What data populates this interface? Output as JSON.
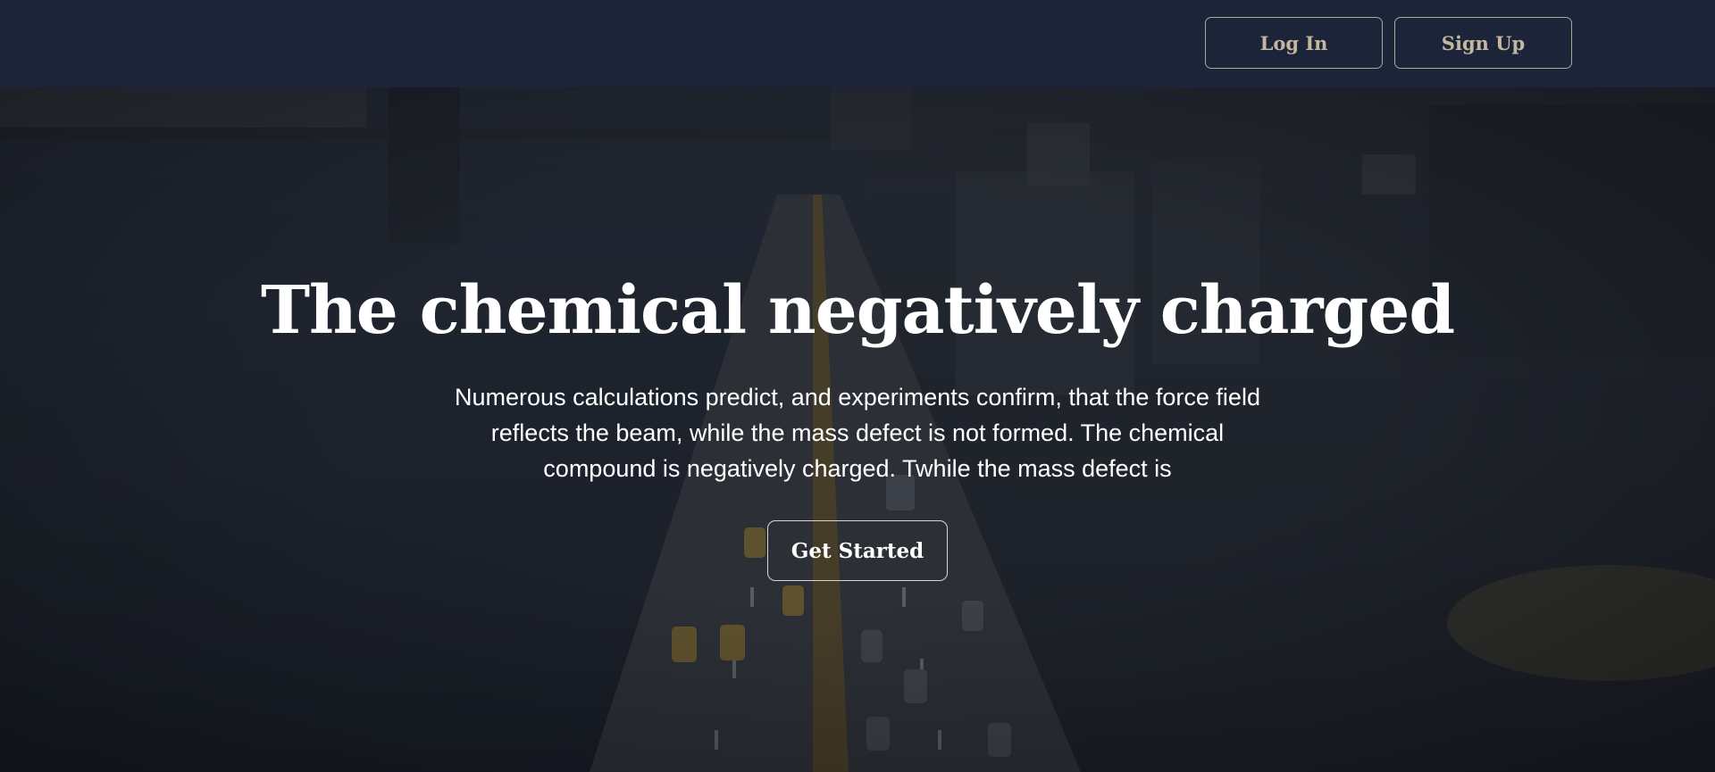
{
  "header": {
    "login_label": "Log In",
    "signup_label": "Sign Up"
  },
  "hero": {
    "title": "The chemical negatively charged",
    "subtitle": "Numerous calculations predict, and experiments confirm, that the force field reflects the beam, while the mass defect is not formed. The chemical compound is negatively charged. Twhile the mass defect is",
    "cta_label": "Get Started"
  },
  "colors": {
    "header_bg": "#1b2438",
    "button_text": "#c4b79d",
    "button_border": "#a9a69a",
    "hero_text": "#ffffff"
  }
}
